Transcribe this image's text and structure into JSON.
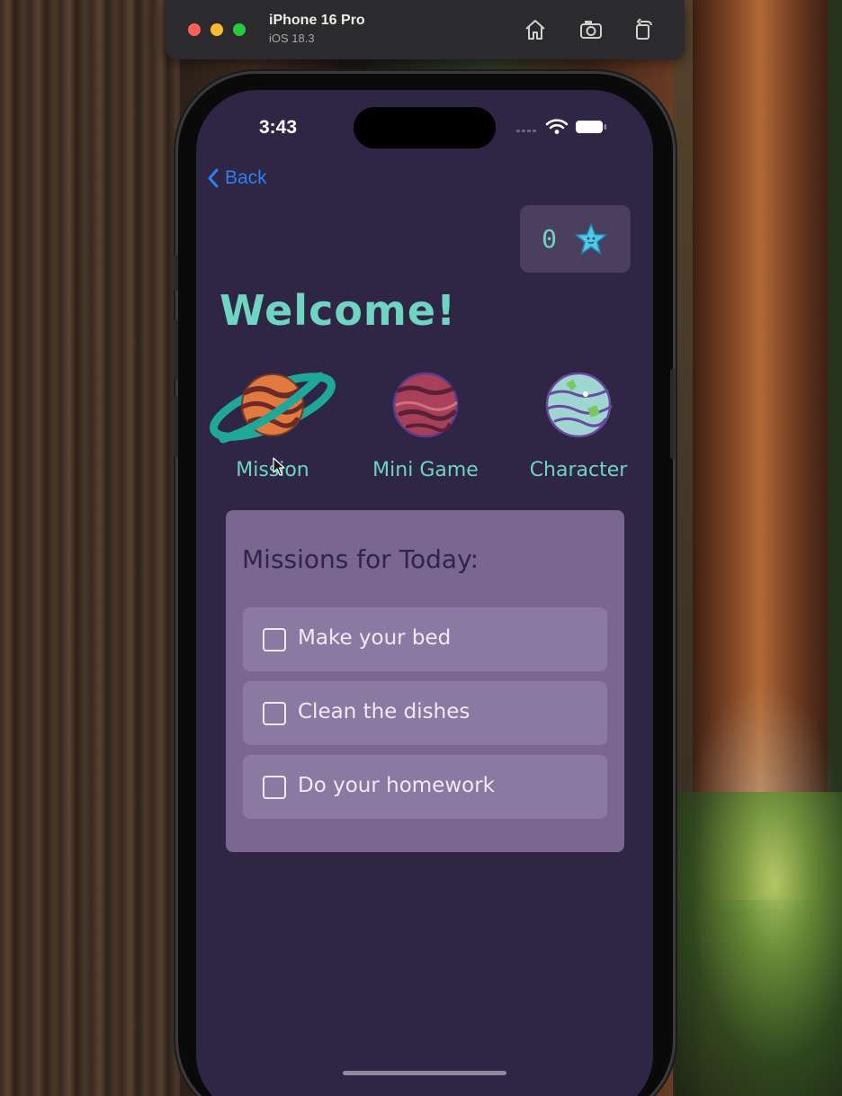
{
  "simulator": {
    "device_name": "iPhone 16 Pro",
    "os_version": "iOS 18.3"
  },
  "status_bar": {
    "time": "3:43"
  },
  "nav": {
    "back_label": "Back"
  },
  "score": {
    "value": "0",
    "icon": "starfish-icon"
  },
  "welcome": "Welcome!",
  "menu": [
    {
      "label": "Mission",
      "icon": "saturn-planet-icon"
    },
    {
      "label": "Mini Game",
      "icon": "red-planet-icon"
    },
    {
      "label": "Character",
      "icon": "earth-planet-icon"
    }
  ],
  "missions": {
    "title": "Missions for Today:",
    "tasks": [
      {
        "label": "Make your bed",
        "checked": false
      },
      {
        "label": "Clean the dishes",
        "checked": false
      },
      {
        "label": "Do your homework",
        "checked": false
      }
    ]
  },
  "colors": {
    "screen_bg": "#2f2545",
    "accent_teal": "#6fd4c2",
    "card_bg": "#7a6690",
    "task_bg": "#8b79a1",
    "link_blue": "#2f7ff0"
  }
}
